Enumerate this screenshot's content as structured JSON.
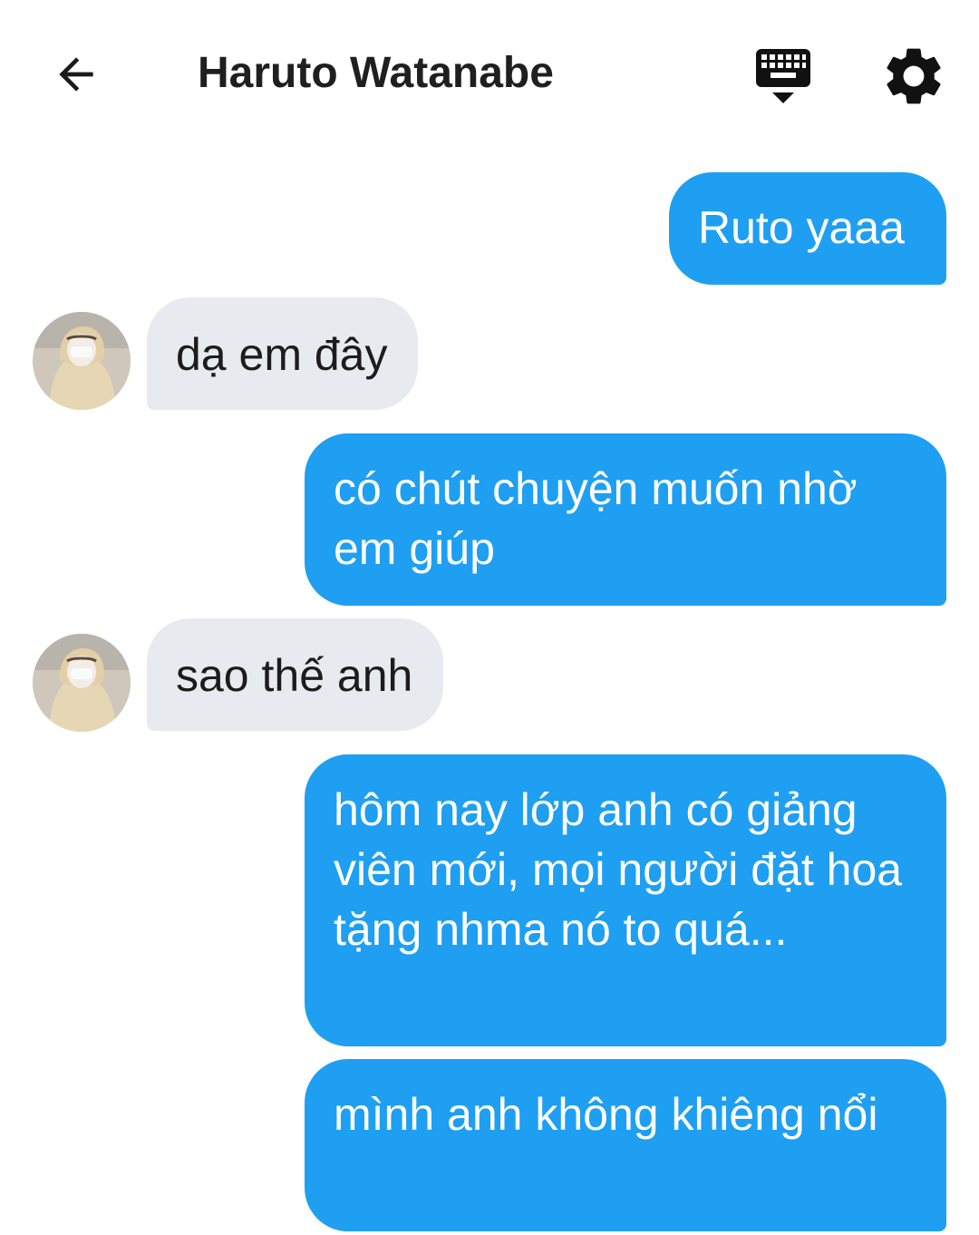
{
  "header": {
    "title": "Haruto Watanabe",
    "back_icon": "arrow-back-icon",
    "keyboard_icon": "keyboard-icon",
    "settings_icon": "gear-icon"
  },
  "colors": {
    "outgoing_bubble": "#1e9ff2",
    "incoming_bubble": "#e7eaee",
    "title_text": "#1f1f1f"
  },
  "messages": [
    {
      "direction": "out",
      "text": "Ruto yaaa"
    },
    {
      "direction": "in",
      "text": "dạ em đây"
    },
    {
      "direction": "out",
      "text": "có chút chuyện muốn nhờ em giúp"
    },
    {
      "direction": "in",
      "text": "sao thế anh"
    },
    {
      "direction": "out",
      "text": "hôm nay lớp anh có giảng viên mới, mọi người đặt hoa tặng nhma nó to quá..."
    },
    {
      "direction": "out",
      "text": "mình anh không khiêng nổi"
    }
  ]
}
